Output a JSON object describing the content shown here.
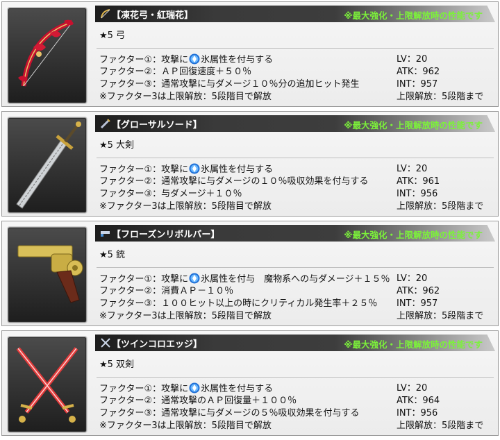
{
  "note": "※最大強化・上限解放時の性能です",
  "weapons": [
    {
      "name": "【凍花弓・紅瑞花】",
      "rarity": "★5 弓",
      "icon": "bow-icon",
      "f1_pre": "ファクター①：攻撃に",
      "f1_post": "氷属性を付与する",
      "f2": "ファクター②：ＡＰ回復速度＋５０％",
      "f3": "ファクター③：通常攻撃に与ダメージ１０％分の追加ヒット発生",
      "f_note": "※ファクター3は上限解放：5段階目で解放",
      "lv": "LV：20",
      "atk": "ATK：962",
      "int": "INT：957",
      "limit": "上限解放：5段階まで"
    },
    {
      "name": "【グローサルソード】",
      "rarity": "★5 大剣",
      "icon": "greatsword-icon",
      "f1_pre": "ファクター①：攻撃に",
      "f1_post": "氷属性を付与する",
      "f2": "ファクター②：通常攻撃に与ダメージの１０％吸収効果を付与する",
      "f3": "ファクター③：与ダメージ＋１０％",
      "f_note": "※ファクター3は上限解放：5段階目で解放",
      "lv": "LV：20",
      "atk": "ATK：961",
      "int": "INT：956",
      "limit": "上限解放：5段階まで"
    },
    {
      "name": "【フローズンリボルバー】",
      "rarity": "★5 銃",
      "icon": "gun-icon",
      "f1_pre": "ファクター①：攻撃に",
      "f1_post": "氷属性を付与　魔物系への与ダメージ＋１５％",
      "f2": "ファクター②：消費ＡＰ－１０％",
      "f3": "ファクター③：１００ヒット以上の時にクリティカル発生率＋２５％",
      "f_note": "※ファクター3は上限解放：5段階目で解放",
      "lv": "LV：20",
      "atk": "ATK：962",
      "int": "INT：957",
      "limit": "上限解放：5段階まで"
    },
    {
      "name": "【ツインコロエッジ】",
      "rarity": "★5 双剣",
      "icon": "twin-swords-icon",
      "f1_pre": "ファクター①：攻撃に",
      "f1_post": "氷属性を付与する",
      "f2": "ファクター②：通常攻撃のＡＰ回復量＋１００％",
      "f3": "ファクター③：通常攻撃に与ダメージの５％吸収効果を付与する",
      "f_note": "※ファクター3は上限解放：5段階目で解放",
      "lv": "LV：20",
      "atk": "ATK：964",
      "int": "INT：956",
      "limit": "上限解放：5段階まで"
    }
  ]
}
